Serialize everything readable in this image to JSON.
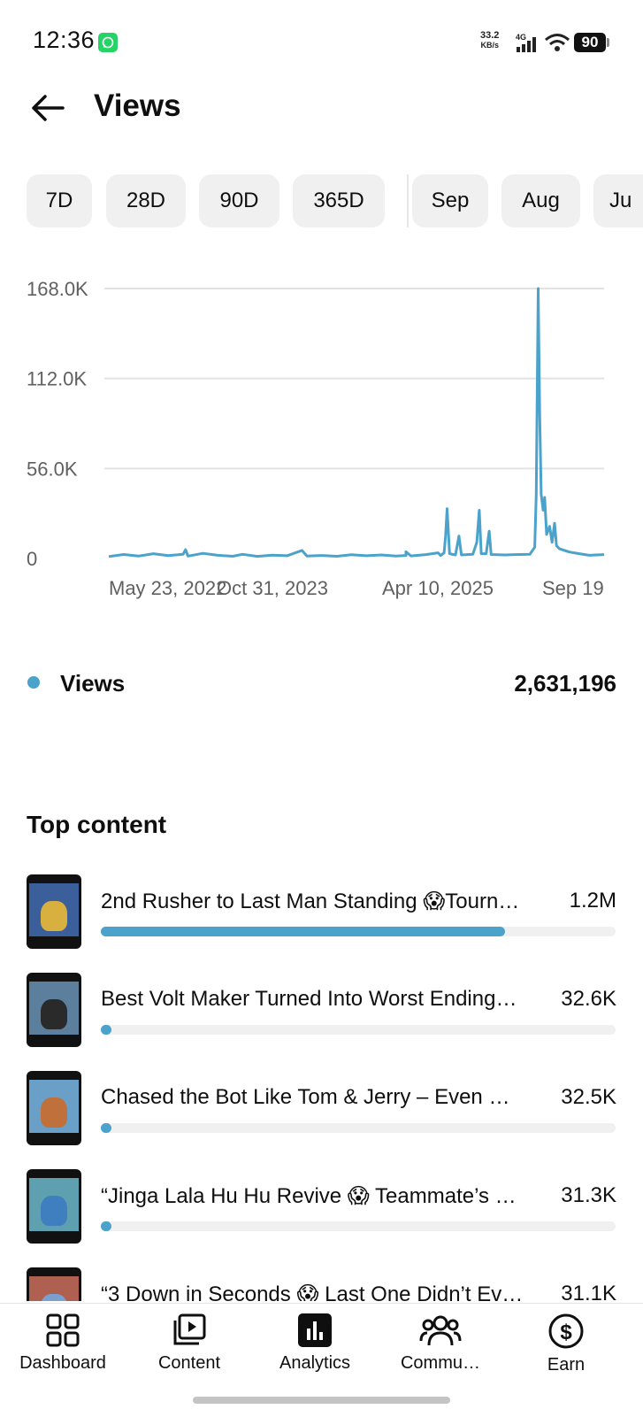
{
  "status_bar": {
    "time": "12:36",
    "network_speed": "33.2",
    "network_unit": "KB/s",
    "network_type": "4G",
    "battery": "90"
  },
  "header": {
    "title": "Views"
  },
  "chips": [
    "7D",
    "28D",
    "90D",
    "365D",
    "Sep",
    "Aug",
    "Ju"
  ],
  "chart": {
    "y_ticks": [
      "168.0K",
      "112.0K",
      "56.0K",
      "0"
    ],
    "x_ticks": [
      "May 23, 2022",
      "Oct 31, 2023",
      "Apr 10, 2025",
      "Sep 19"
    ],
    "line_color": "#4ba2cb"
  },
  "chart_data": {
    "type": "line",
    "x_labels": [
      "May 23, 2022",
      "Oct 31, 2023",
      "Apr 10, 2025",
      "Sep 19"
    ],
    "ylim": [
      0,
      168000
    ],
    "y_ticks": [
      0,
      56000,
      112000,
      168000
    ],
    "grid": true,
    "series": [
      {
        "name": "Views",
        "color": "#4ba2cb",
        "points": [
          [
            0,
            1200
          ],
          [
            0.03,
            2500
          ],
          [
            0.06,
            1500
          ],
          [
            0.09,
            3000
          ],
          [
            0.12,
            1800
          ],
          [
            0.15,
            2600
          ],
          [
            0.155,
            5500
          ],
          [
            0.16,
            1500
          ],
          [
            0.19,
            3200
          ],
          [
            0.22,
            2000
          ],
          [
            0.25,
            1400
          ],
          [
            0.27,
            2600
          ],
          [
            0.3,
            1300
          ],
          [
            0.33,
            2100
          ],
          [
            0.36,
            1700
          ],
          [
            0.39,
            5000
          ],
          [
            0.4,
            1500
          ],
          [
            0.43,
            1900
          ],
          [
            0.46,
            1400
          ],
          [
            0.49,
            2300
          ],
          [
            0.52,
            1700
          ],
          [
            0.55,
            2200
          ],
          [
            0.58,
            1500
          ],
          [
            0.6,
            1900
          ],
          [
            0.6,
            4200
          ],
          [
            0.61,
            1600
          ],
          [
            0.64,
            2400
          ],
          [
            0.665,
            3500
          ],
          [
            0.67,
            1800
          ],
          [
            0.677,
            3500
          ],
          [
            0.68,
            14000
          ],
          [
            0.683,
            31000
          ],
          [
            0.688,
            3000
          ],
          [
            0.7,
            2200
          ],
          [
            0.707,
            14000
          ],
          [
            0.712,
            2200
          ],
          [
            0.735,
            2600
          ],
          [
            0.743,
            10000
          ],
          [
            0.748,
            30000
          ],
          [
            0.752,
            3000
          ],
          [
            0.762,
            3000
          ],
          [
            0.768,
            17000
          ],
          [
            0.772,
            2500
          ],
          [
            0.8,
            2200
          ],
          [
            0.82,
            2400
          ],
          [
            0.85,
            2600
          ],
          [
            0.86,
            7000
          ],
          [
            0.863,
            40000
          ],
          [
            0.867,
            168000
          ],
          [
            0.87,
            90000
          ],
          [
            0.873,
            40000
          ],
          [
            0.877,
            30000
          ],
          [
            0.88,
            38000
          ],
          [
            0.884,
            15000
          ],
          [
            0.89,
            20000
          ],
          [
            0.895,
            10000
          ],
          [
            0.9,
            22000
          ],
          [
            0.904,
            8000
          ],
          [
            0.91,
            6000
          ],
          [
            0.93,
            4000
          ],
          [
            0.95,
            3000
          ],
          [
            0.97,
            2000
          ],
          [
            1.0,
            2400
          ]
        ]
      }
    ]
  },
  "legend": {
    "label": "Views",
    "total": "2,631,196"
  },
  "top_content": {
    "title": "Top content",
    "items": [
      {
        "title": "2nd Rusher to Last Man Standing 😱Tourn…",
        "value": "1.2M",
        "fraction": 0.785,
        "sky": "#3b5f9a",
        "fig": "#d8b040"
      },
      {
        "title": "Best Volt Maker Turned Into Worst Ending…",
        "value": "32.6K",
        "fraction": 0.021,
        "sky": "#5d7f9e",
        "fig": "#2a2a2a"
      },
      {
        "title": "Chased the Bot Like Tom & Jerry – Even …",
        "value": "32.5K",
        "fraction": 0.021,
        "sky": "#6aa0c8",
        "fig": "#c0703a"
      },
      {
        "title": "“Jinga Lala Hu Hu Revive 😱 Teammate’s …",
        "value": "31.3K",
        "fraction": 0.02,
        "sky": "#5ea0b0",
        "fig": "#3f7fbf"
      },
      {
        "title": "“3 Down in Seconds 😱 Last One Didn’t Ev…",
        "value": "31.1K",
        "fraction": 0.02,
        "sky": "#b06050",
        "fig": "#7aa0d0"
      }
    ]
  },
  "bottom_nav": {
    "items": [
      {
        "label": "Dashboard",
        "icon": "dashboard-icon"
      },
      {
        "label": "Content",
        "icon": "content-icon"
      },
      {
        "label": "Analytics",
        "icon": "analytics-icon"
      },
      {
        "label": "Commu…",
        "icon": "community-icon"
      },
      {
        "label": "Earn",
        "icon": "earn-icon"
      }
    ]
  }
}
